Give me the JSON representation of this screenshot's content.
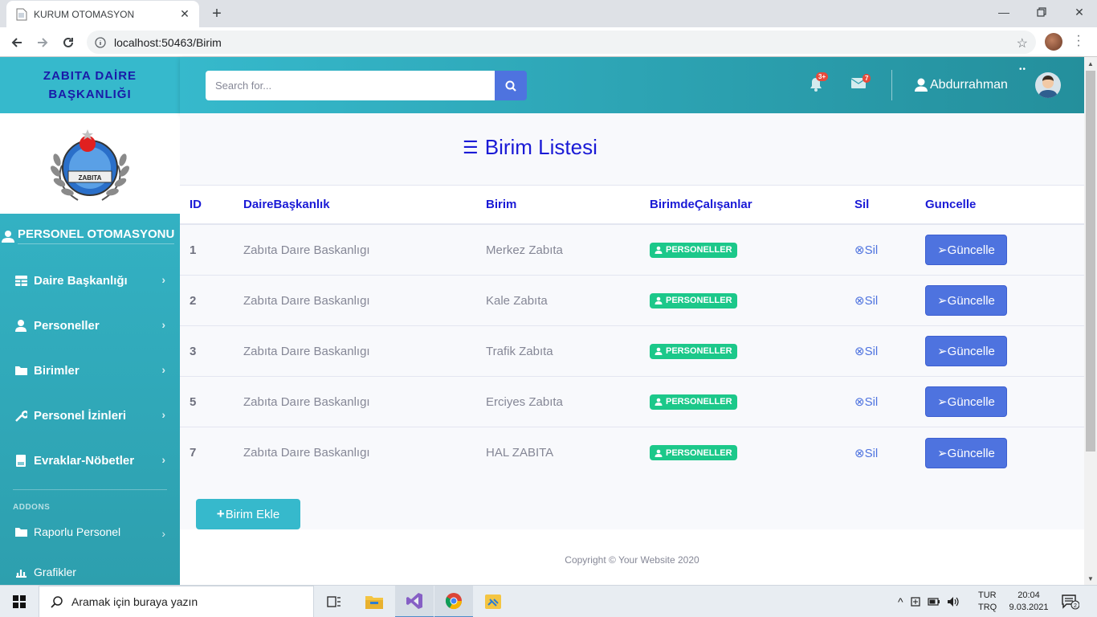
{
  "browser": {
    "tab_title": "KURUM OTOMASYON",
    "url": "localhost:50463/Birim"
  },
  "sidebar": {
    "brand_line1": "ZABITA DAİRE",
    "brand_line2": "BAŞKANLIĞI",
    "logo_text": "ZABITA",
    "heading": "PERSONEL OTOMASYONU",
    "items": [
      {
        "label": "Daire Başkanlığı",
        "icon": "table-icon"
      },
      {
        "label": "Personeller",
        "icon": "user-icon"
      },
      {
        "label": "Birimler",
        "icon": "folder-icon"
      },
      {
        "label": "Personel İzinleri",
        "icon": "wrench-icon"
      },
      {
        "label": "Evraklar-Nöbetler",
        "icon": "file-icon"
      }
    ],
    "addons_label": "ADDONS",
    "addon_items": [
      {
        "label": "Raporlu Personel",
        "icon": "folder-icon"
      },
      {
        "label": "Grafikler",
        "icon": "chart-icon"
      }
    ]
  },
  "topbar": {
    "search_placeholder": "Search for...",
    "alerts_badge": "3+",
    "messages_badge": "7",
    "username": "Abdurrahman"
  },
  "main": {
    "title": "Birim Listesi",
    "columns": {
      "id": "ID",
      "daire": "DaireBaşkanlık",
      "birim": "Birim",
      "calisanlar": "BirimdeÇalışanlar",
      "sil": "Sil",
      "guncelle": "Guncelle"
    },
    "rows": [
      {
        "id": "1",
        "daire": "Zabıta Daıre Baskanlıgı",
        "birim": "Merkez Zabıta",
        "personel": "PERSONELLER",
        "sil": "⊗Sil",
        "guncelle": "➢Güncelle"
      },
      {
        "id": "2",
        "daire": "Zabıta Daıre Baskanlıgı",
        "birim": "Kale Zabıta",
        "personel": "PERSONELLER",
        "sil": "⊗Sil",
        "guncelle": "➢Güncelle"
      },
      {
        "id": "3",
        "daire": "Zabıta Daıre Baskanlıgı",
        "birim": "Trafik Zabıta",
        "personel": "PERSONELLER",
        "sil": "⊗Sil",
        "guncelle": "➢Güncelle"
      },
      {
        "id": "5",
        "daire": "Zabıta Daıre Baskanlıgı",
        "birim": "Erciyes Zabıta",
        "personel": "PERSONELLER",
        "sil": "⊗Sil",
        "guncelle": "➢Güncelle"
      },
      {
        "id": "7",
        "daire": "Zabıta Daıre Baskanlıgı",
        "birim": "HAL ZABITA",
        "personel": "PERSONELLER",
        "sil": "⊗Sil",
        "guncelle": "➢Güncelle"
      }
    ],
    "add_button": "Birim Ekle",
    "footer": "Copyright © Your Website 2020"
  },
  "taskbar": {
    "search_placeholder": "Aramak için buraya yazın",
    "lang_line1": "TUR",
    "lang_line2": "TRQ",
    "time": "20:04",
    "date": "9.03.2021",
    "notifications": "2"
  },
  "colors": {
    "sidebar": "#36b9cc",
    "primary": "#4e73df",
    "success": "#1cc88a",
    "title_blue": "#1a1ad6"
  }
}
